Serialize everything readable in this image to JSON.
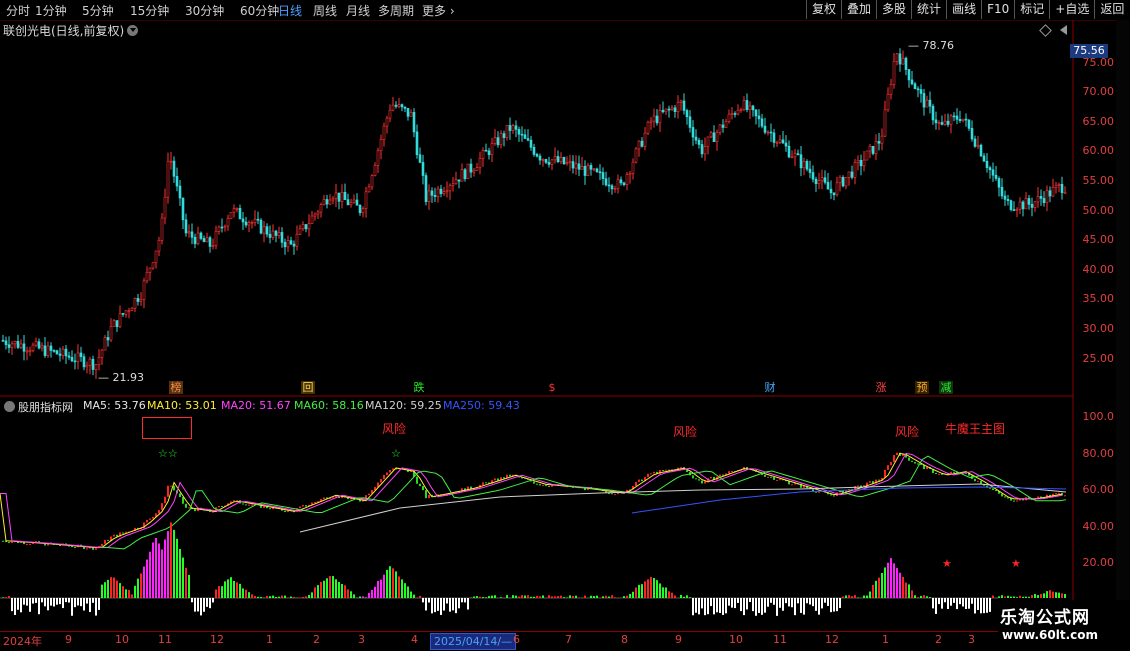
{
  "periods": [
    "分时",
    "1分钟",
    "5分钟",
    "15分钟",
    "30分钟",
    "60分钟",
    "日线",
    "周线",
    "月线",
    "多周期",
    "更多"
  ],
  "active_period": "日线",
  "toolbar": [
    "复权",
    "叠加",
    "多股",
    "统计",
    "画线",
    "F10",
    "标记",
    "+自选",
    "返回"
  ],
  "title": "联创光电(日线,前复权)",
  "price_axis": [
    "75.00",
    "70.00",
    "65.00",
    "60.00",
    "55.00",
    "50.00",
    "45.00",
    "40.00",
    "35.00",
    "30.00",
    "25.00"
  ],
  "last_price": "75.56",
  "high_label": "78.76",
  "low_label": "21.93",
  "event_marks": [
    {
      "t": "榜",
      "color": "#ff8844",
      "bg": "#553311"
    },
    {
      "t": "回",
      "color": "#ffcc66",
      "bg": "#443300"
    },
    {
      "t": "跌",
      "color": "#22ee22",
      "bg": "#000"
    },
    {
      "t": "$",
      "color": "#ff3333",
      "bg": "#000"
    },
    {
      "t": "财",
      "color": "#44aaff",
      "bg": "#000"
    },
    {
      "t": "涨",
      "color": "#ff4444",
      "bg": "#000"
    },
    {
      "t": "预",
      "color": "#ffaa33",
      "bg": "#332200"
    },
    {
      "t": "减",
      "color": "#22ee22",
      "bg": "#000"
    }
  ],
  "indicator": {
    "name": "股朋指标网",
    "lines": [
      {
        "label": "MA5: 53.76",
        "color": "#e8e8e8"
      },
      {
        "label": "MA10: 53.01",
        "color": "#ffee33"
      },
      {
        "label": "MA20: 51.67",
        "color": "#ff44ff"
      },
      {
        "label": "MA60: 58.16",
        "color": "#44ee44"
      },
      {
        "label": "MA120: 59.25",
        "color": "#d0d0d0"
      },
      {
        "label": "MA250: 59.43",
        "color": "#3355ff"
      }
    ],
    "axis": [
      "100.0",
      "80.00",
      "60.00",
      "40.00",
      "20.00"
    ],
    "risk_label": "风险",
    "chart_name": "牛魔王主图"
  },
  "dates": [
    "2024年",
    "9",
    "10",
    "11",
    "12",
    "1",
    "2",
    "3",
    "4",
    "2025/04/14/—",
    "6",
    "7",
    "8",
    "9",
    "10",
    "11",
    "12",
    "1",
    "2",
    "3"
  ],
  "watermark": {
    "title": "乐淘公式网",
    "url": "www.60lt.com"
  }
}
